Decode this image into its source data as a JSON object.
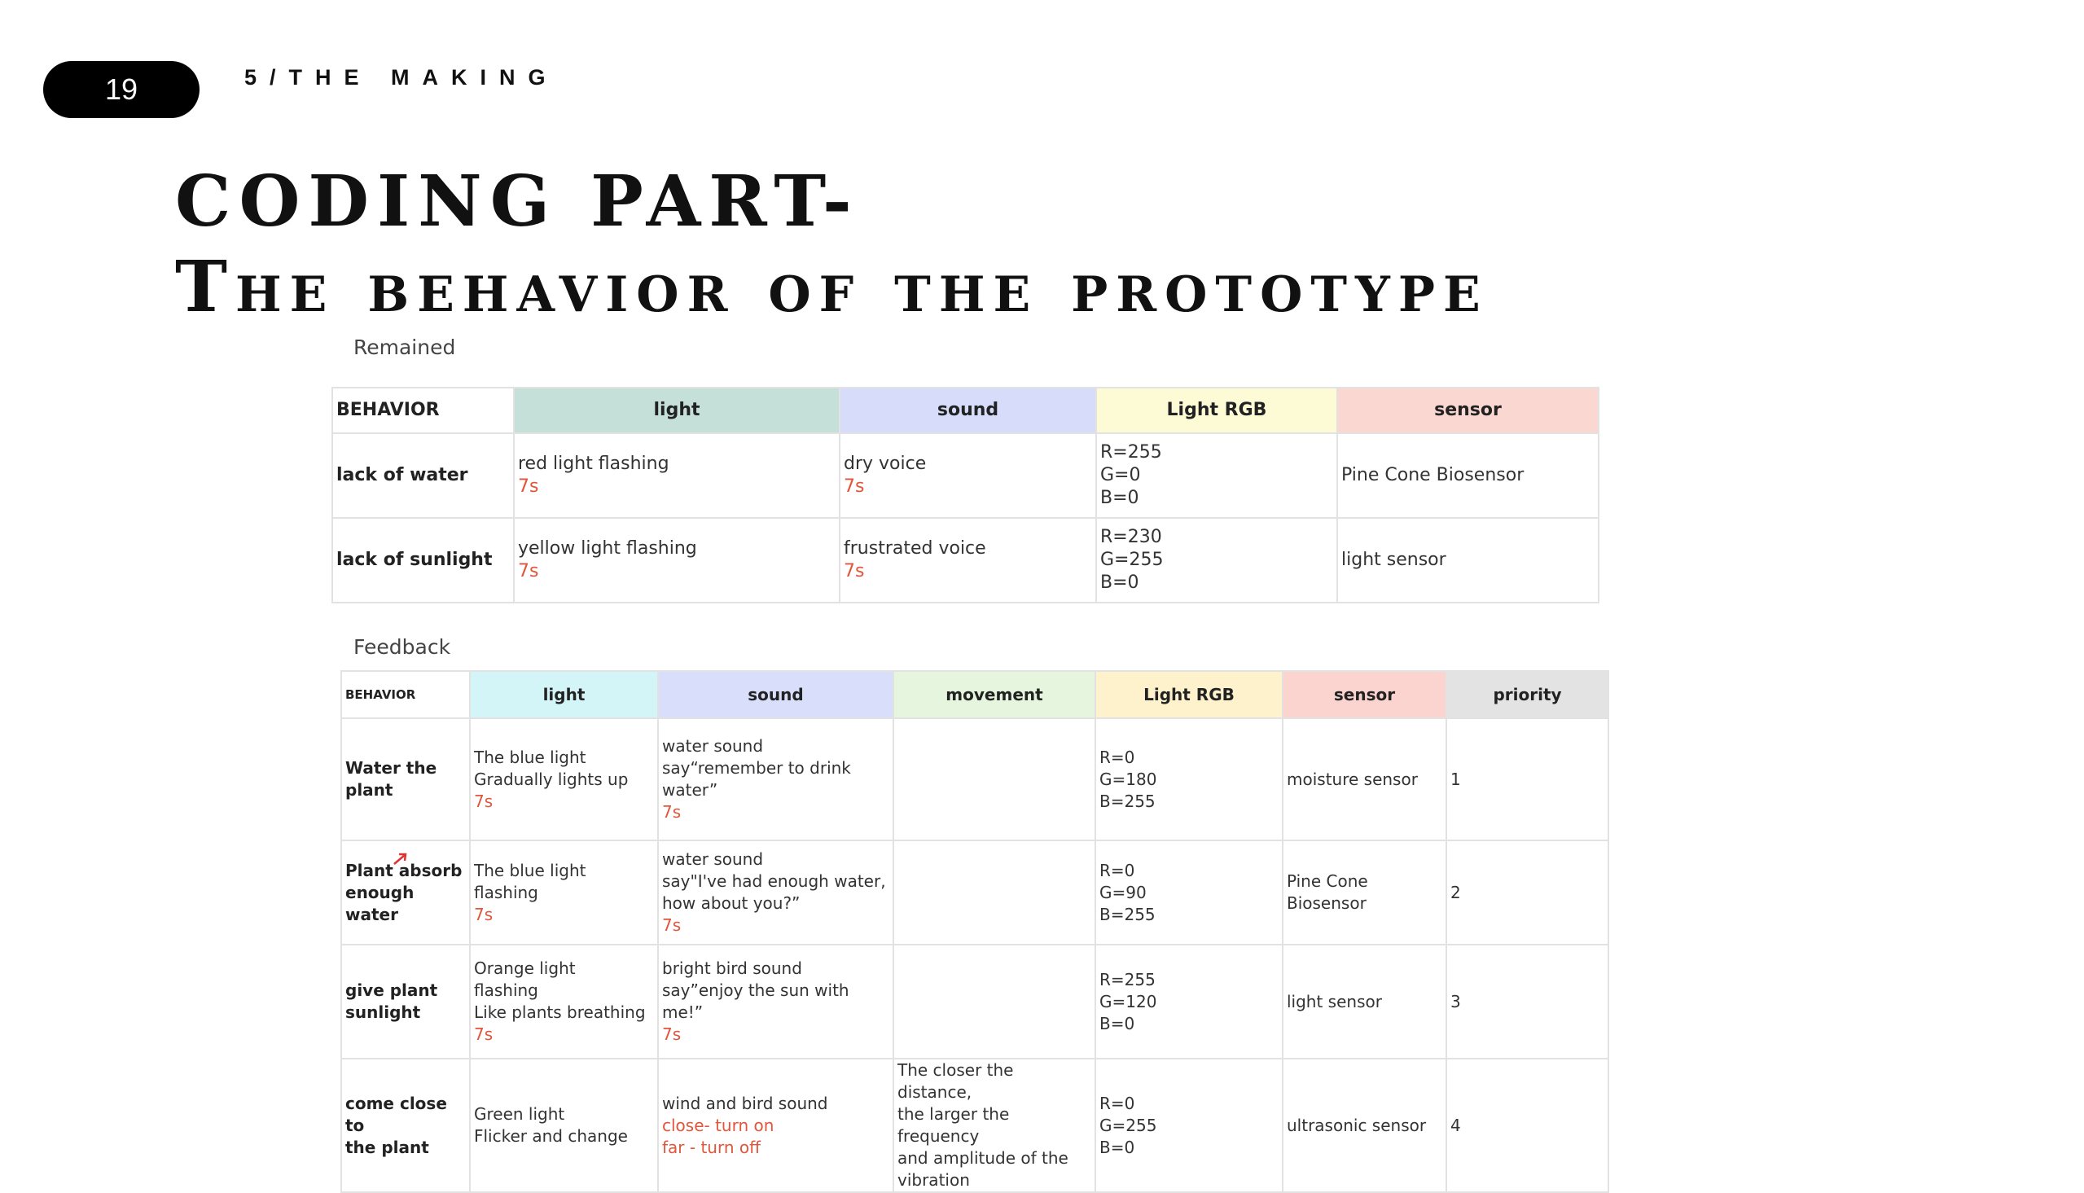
{
  "header": {
    "page_number": "19",
    "section": "5/THE MAKING"
  },
  "title": {
    "line1": "CODING PART-",
    "line2": "The behavior of the prototype"
  },
  "colors": {
    "light_header": "#c5e0d8",
    "sound_header": "#d6dcfa",
    "light_rgb_header": "#fdfad6",
    "sensor_header": "#fbd7d2",
    "feedback_light_header": "#d4f5f8",
    "feedback_sound_header": "#d9defb",
    "movement_header": "#e6f5de",
    "feedback_rgb_header": "#fdf2cc",
    "feedback_sensor_header": "#fbd3cf",
    "priority_header": "#e3e3e3",
    "accent_red": "#e2553b"
  },
  "remained": {
    "caption": "Remained",
    "headers": [
      "BEHAVIOR",
      "light",
      "sound",
      "Light RGB",
      "sensor"
    ],
    "rows": [
      {
        "behavior": "lack of water",
        "light": "red light flashing",
        "light_time": "7s",
        "sound": "dry voice",
        "sound_time": "7s",
        "rgb": [
          "R=255",
          "G=0",
          "B=0"
        ],
        "sensor": "Pine Cone Biosensor"
      },
      {
        "behavior": "lack of sunlight",
        "light": "yellow light flashing",
        "light_time": "7s",
        "sound": "frustrated voice",
        "sound_time": "7s",
        "rgb": [
          "R=230",
          "G=255",
          "B=0"
        ],
        "sensor": "light sensor"
      }
    ]
  },
  "feedback": {
    "caption": "Feedback",
    "headers": [
      "BEHAVIOR",
      "light",
      "sound",
      "movement",
      "Light RGB",
      "sensor",
      "priority"
    ],
    "rows": [
      {
        "behavior": [
          "Water the",
          "plant"
        ],
        "light": [
          "The blue light",
          "Gradually lights up"
        ],
        "light_time": "7s",
        "sound": [
          "water sound",
          "say“remember to drink water”"
        ],
        "sound_time": "7s",
        "movement": [],
        "rgb": [
          "R=0",
          "G=180",
          "B=255"
        ],
        "sensor": "moisture sensor",
        "priority": "1"
      },
      {
        "behavior": [
          "Plant absorb",
          "enough water"
        ],
        "light": [
          "The blue light",
          "flashing"
        ],
        "light_time": "7s",
        "sound": [
          "water sound",
          "say\"I've had enough water,",
          "how about you?”"
        ],
        "sound_time": "7s",
        "movement": [],
        "rgb": [
          "R=0",
          "G=90",
          "B=255"
        ],
        "sensor": "Pine Cone Biosensor",
        "priority": "2"
      },
      {
        "behavior": [
          "give plant",
          "sunlight"
        ],
        "light": [
          "Orange light",
          "flashing",
          "Like plants breathing"
        ],
        "light_time": "7s",
        "sound": [
          "bright bird sound",
          "say”enjoy the sun with me!”"
        ],
        "sound_time": "7s",
        "movement": [],
        "rgb": [
          "R=255",
          "G=120",
          "B=0"
        ],
        "sensor": "light sensor",
        "priority": "3"
      },
      {
        "behavior": [
          "come close to",
          "the plant"
        ],
        "light": [
          "Green light",
          "Flicker and change"
        ],
        "light_time": "",
        "sound": [
          "wind and bird sound"
        ],
        "sound_red": [
          "close- turn on",
          " far - turn off"
        ],
        "sound_time": "",
        "movement": [
          "The closer the distance,",
          "the larger the frequency",
          "and amplitude of the",
          "vibration"
        ],
        "rgb": [
          "R=0",
          "G=255",
          "B=0"
        ],
        "sensor": "ultrasonic sensor",
        "priority": "4"
      }
    ]
  }
}
